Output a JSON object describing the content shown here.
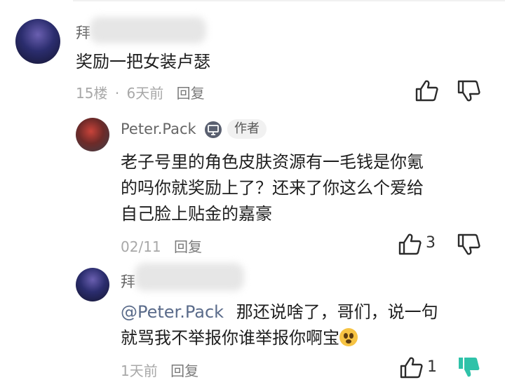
{
  "comments": [
    {
      "username": "拜",
      "text": "奖励一把女装卢瑟",
      "floor": "15楼",
      "sep": "·",
      "time": "6天前",
      "reply": "回复"
    },
    {
      "username": "Peter.Pack",
      "badge": "作者",
      "text_lines": [
        "老子号里的角色皮肤资源有一毛钱是你氪",
        "的吗你就奖励上了？还来了你这么个爱给",
        "自己脸上贴金的嘉豪"
      ],
      "time": "02/11",
      "reply": "回复",
      "likes": "3"
    },
    {
      "username": "拜",
      "mention": "@Peter.Pack",
      "text_line1": "那还说啥了，哥们，说一句",
      "text_line2": "就骂我不举报你谁举报你啊宝",
      "emoji": "astonished-face",
      "time": "1天前",
      "reply": "回复",
      "likes": "1"
    }
  ],
  "colors": {
    "disliked_active": "#2fc2a9",
    "meta_gray": "#a8a8a8",
    "icon_dark": "#2b2b2b"
  }
}
